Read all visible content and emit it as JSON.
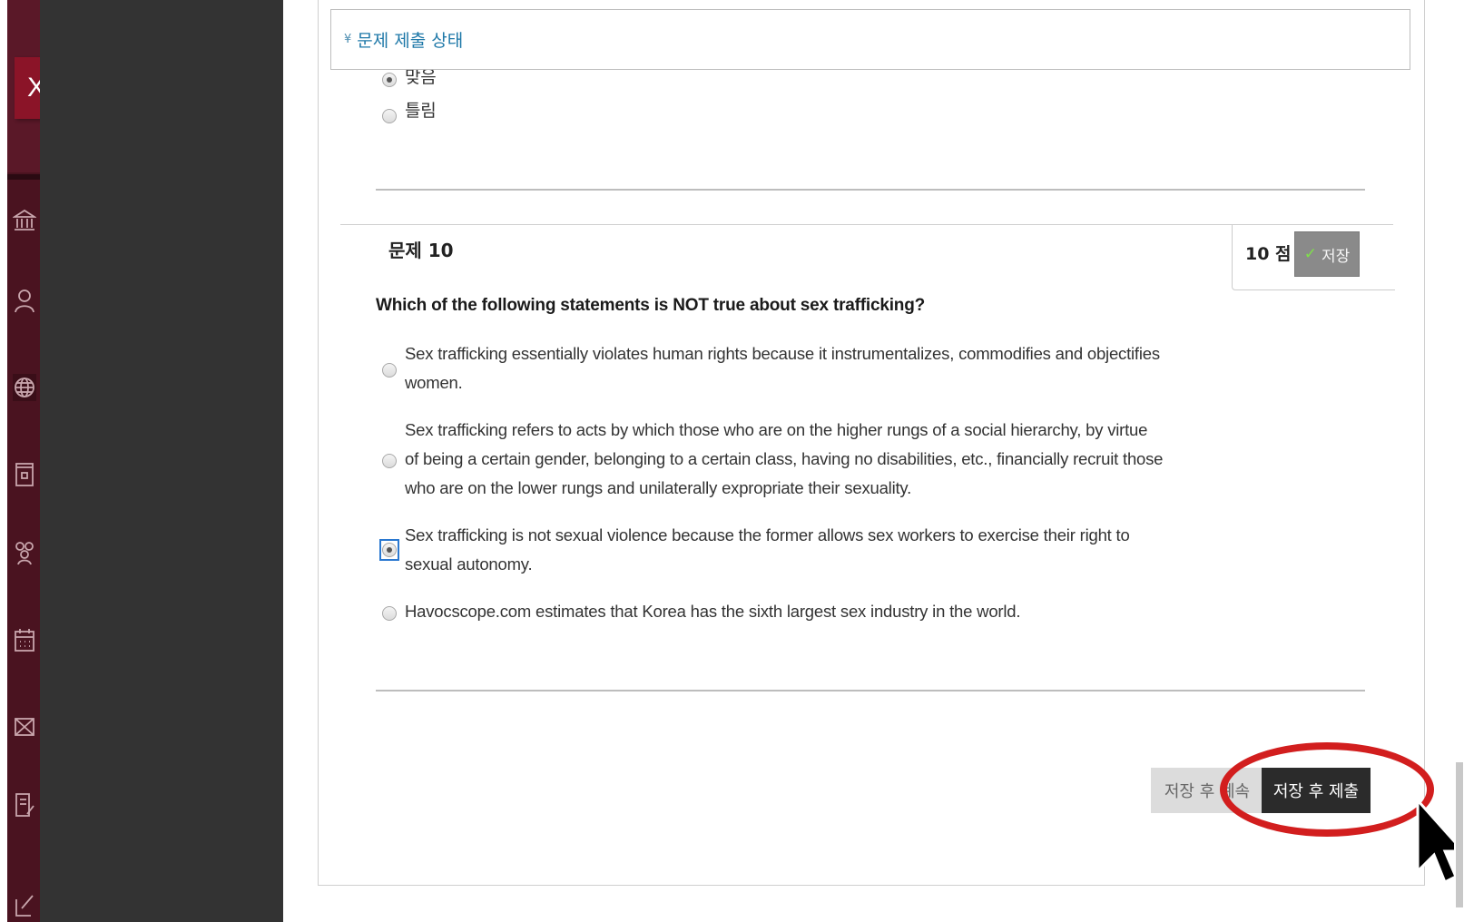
{
  "sidebar": {
    "close_label": "X",
    "icons": [
      "institution-icon",
      "person-icon",
      "globe-icon",
      "book-icon",
      "groups-icon",
      "calendar-icon",
      "mail-icon",
      "document-edit-icon",
      "compose-icon"
    ]
  },
  "status_bar": {
    "label": "문제 제출 상태"
  },
  "previous_question": {
    "options": [
      {
        "label": "맞음",
        "checked": true
      },
      {
        "label": "틀림",
        "checked": false
      }
    ]
  },
  "question10": {
    "title": "문제 10",
    "points": "10 점",
    "save_label": "저장",
    "text": "Which of the following statements is NOT true about sex trafficking?",
    "options": [
      {
        "lines": [
          "Sex trafficking essentially violates human rights because it instrumentalizes, commodifies and objectifies",
          "women."
        ],
        "checked": false
      },
      {
        "lines": [
          "Sex trafficking refers to acts by which those who are on the higher rungs of a social hierarchy, by virtue",
          "of being a certain gender, belonging to a certain class, having no disabilities, etc., financially recruit those",
          "who are on the lower rungs and unilaterally expropriate their sexuality."
        ],
        "checked": false
      },
      {
        "lines": [
          "Sex trafficking is not sexual violence because the former allows sex workers to exercise their right to",
          "sexual autonomy."
        ],
        "checked": true
      },
      {
        "lines": [
          "Havocscope.com estimates that Korea has the sixth largest sex industry in the world."
        ],
        "checked": false
      }
    ]
  },
  "footer": {
    "save_continue_label": "저장 후 계속",
    "save_submit_label": "저장 후 제출"
  },
  "colors": {
    "rail": "#4a1320",
    "close_button": "#8b1428",
    "highlight": "#d21e1e",
    "link": "#1e78a8"
  }
}
